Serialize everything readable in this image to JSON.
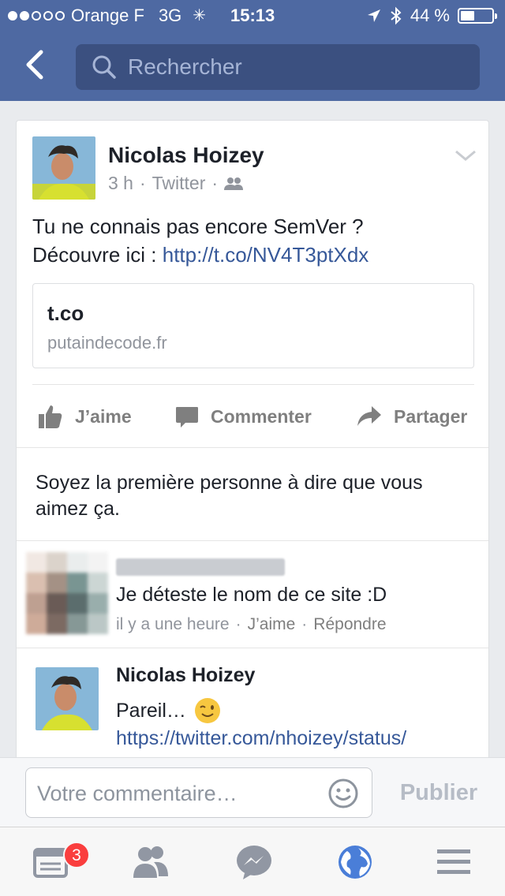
{
  "status_bar": {
    "carrier": "Orange F",
    "network": "3G",
    "time": "15:13",
    "battery": "44 %",
    "signal_bars": 2,
    "battery_level": 0.44
  },
  "nav": {
    "search_placeholder": "Rechercher",
    "accent_color": "#4e69a2"
  },
  "post": {
    "author": "Nicolas Hoizey",
    "time": "3 h",
    "source": "Twitter",
    "text_line1": "Tu ne connais pas encore SemVer ?",
    "text_line2_prefix": "Découvre ici : ",
    "text_link": "http://t.co/NV4T3ptXdx",
    "preview": {
      "title": "t.co",
      "domain": "putaindecode.fr"
    }
  },
  "actions": {
    "like": "J’aime",
    "comment": "Commenter",
    "share": "Partager"
  },
  "likes_text": "Soyez la première personne à dire que vous aimez ça.",
  "comments": [
    {
      "text": "Je déteste le nom de ce site :D",
      "time": "il y a une heure",
      "like": "J’aime",
      "reply": "Répondre"
    },
    {
      "author": "Nicolas Hoizey",
      "text": "Pareil…",
      "link": "https://twitter.com/nhoizey/status/"
    }
  ],
  "composer": {
    "placeholder": "Votre commentaire…",
    "publish_label": "Publier"
  },
  "tabbar": {
    "feed_badge": "3"
  }
}
